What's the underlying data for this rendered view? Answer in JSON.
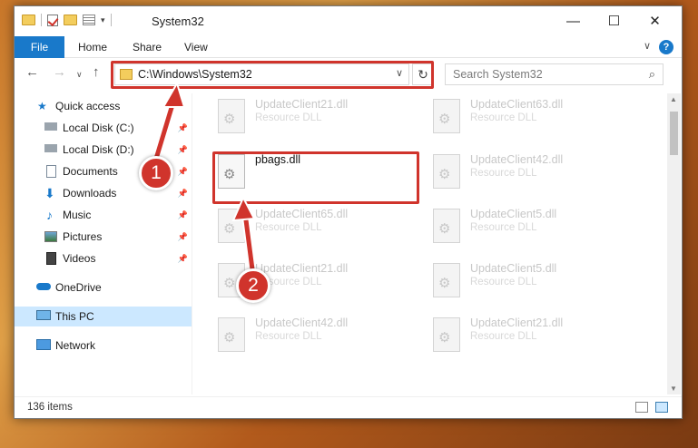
{
  "window": {
    "title": "System32"
  },
  "ribbon": {
    "tabs": [
      "File",
      "Home",
      "Share",
      "View"
    ]
  },
  "address": {
    "path": "C:\\Windows\\System32",
    "search_placeholder": "Search System32"
  },
  "nav": {
    "items": [
      {
        "label": "Quick access",
        "icon": "star-icon",
        "pinned": false
      },
      {
        "label": "Local Disk (C:)",
        "icon": "drive-icon",
        "pinned": true
      },
      {
        "label": "Local Disk (D:)",
        "icon": "drive-icon",
        "pinned": true
      },
      {
        "label": "Documents",
        "icon": "documents-icon",
        "pinned": true
      },
      {
        "label": "Downloads",
        "icon": "download-icon",
        "pinned": true
      },
      {
        "label": "Music",
        "icon": "music-icon",
        "pinned": true
      },
      {
        "label": "Pictures",
        "icon": "pictures-icon",
        "pinned": true
      },
      {
        "label": "Videos",
        "icon": "videos-icon",
        "pinned": true
      },
      {
        "label": "OneDrive",
        "icon": "cloud-icon",
        "pinned": false
      },
      {
        "label": "This PC",
        "icon": "computer-icon",
        "pinned": false
      },
      {
        "label": "Network",
        "icon": "network-icon",
        "pinned": false
      }
    ]
  },
  "files": [
    {
      "name": "UpdateClient21.dll",
      "type": "Resource DLL"
    },
    {
      "name": "UpdateClient63.dll",
      "type": "Resource DLL"
    },
    {
      "name": "pbags.dll",
      "type": ""
    },
    {
      "name": "UpdateClient42.dll",
      "type": "Resource DLL"
    },
    {
      "name": "UpdateClient65.dll",
      "type": "Resource DLL"
    },
    {
      "name": "UpdateClient5.dll",
      "type": "Resource DLL"
    },
    {
      "name": "UpdateClient21.dll",
      "type": "Resource DLL"
    },
    {
      "name": "UpdateClient5.dll",
      "type": "Resource DLL"
    },
    {
      "name": "UpdateClient42.dll",
      "type": "Resource DLL"
    },
    {
      "name": "UpdateClient21.dll",
      "type": "Resource DLL"
    }
  ],
  "status": {
    "count": "136 items"
  },
  "callouts": [
    "1",
    "2"
  ],
  "colors": {
    "accent": "#1979ca",
    "highlight": "#d0342c",
    "selected": "#cce8ff"
  }
}
